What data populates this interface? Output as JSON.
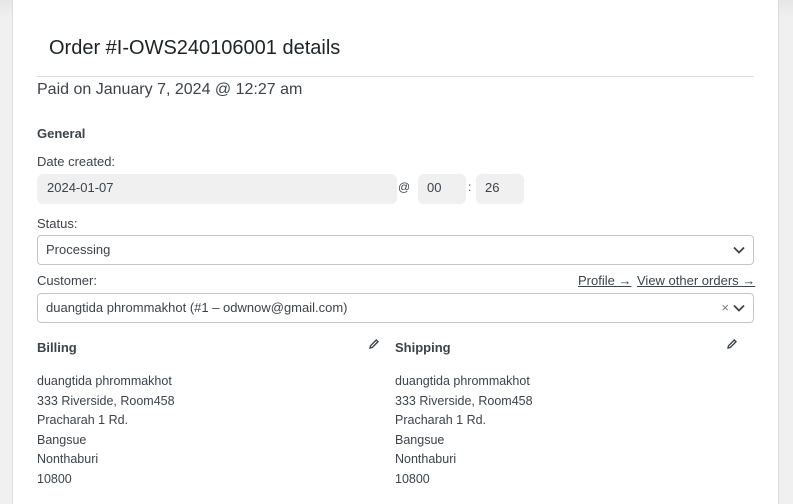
{
  "order": {
    "title": "Order #I-OWS240106001 details",
    "paid_text": "Paid on January 7, 2024 @ 12:27 am"
  },
  "general": {
    "heading": "General",
    "date_label": "Date created:",
    "date_value": "2024-01-07",
    "at_sign": "@",
    "hour": "00",
    "time_sep": ":",
    "minute": "26",
    "status_label": "Status:",
    "status_value": "Processing",
    "customer_label": "Customer:",
    "profile_link": "Profile →",
    "view_orders_link": "View other orders →",
    "customer_value": "duangtida phrommakhot (#1 – odwnow@gmail.com)",
    "clear_symbol": "×"
  },
  "billing": {
    "heading": "Billing",
    "lines": [
      "duangtida phrommakhot",
      "333 Riverside, Room458",
      "Pracharah 1 Rd.",
      "Bangsue",
      "Nonthaburi",
      "10800"
    ]
  },
  "shipping": {
    "heading": "Shipping",
    "lines": [
      "duangtida phrommakhot",
      "333 Riverside, Room458",
      "Pracharah 1 Rd.",
      "Bangsue",
      "Nonthaburi",
      "10800"
    ]
  },
  "icons": {
    "select_chevron": "chevron-down-icon",
    "edit": "pencil-icon"
  }
}
